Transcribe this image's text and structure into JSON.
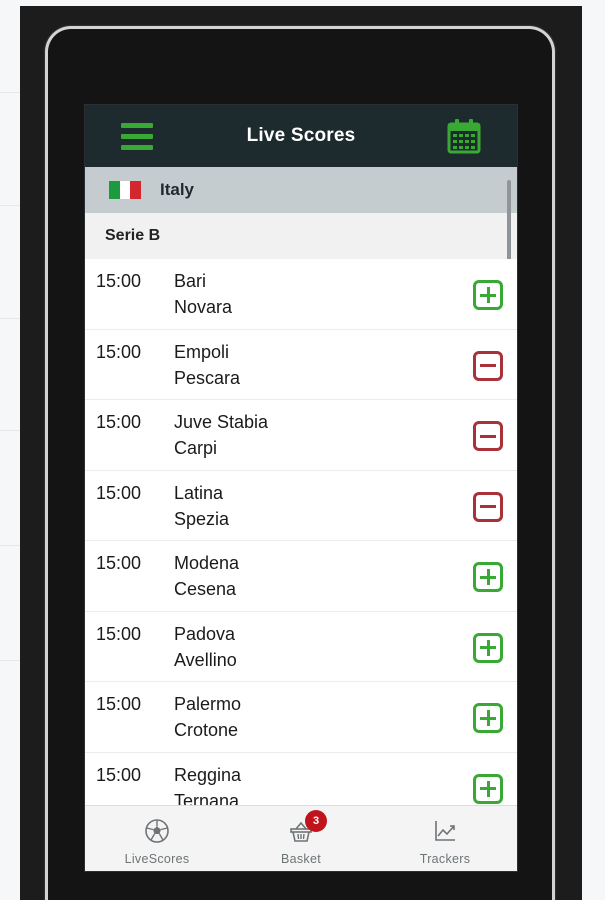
{
  "header": {
    "title": "Live Scores",
    "menu_icon": "hamburger-menu-icon",
    "calendar_icon": "calendar-icon"
  },
  "country": {
    "name": "Italy",
    "flag_colors": [
      "#1c9a3e",
      "#ffffff",
      "#d3262e"
    ]
  },
  "league": {
    "name": "Serie B"
  },
  "matches": [
    {
      "time": "15:00",
      "home": "Bari",
      "away": "Novara",
      "action": "add"
    },
    {
      "time": "15:00",
      "home": "Empoli",
      "away": "Pescara",
      "action": "remove"
    },
    {
      "time": "15:00",
      "home": "Juve Stabia",
      "away": "Carpi",
      "action": "remove"
    },
    {
      "time": "15:00",
      "home": "Latina",
      "away": "Spezia",
      "action": "remove"
    },
    {
      "time": "15:00",
      "home": "Modena",
      "away": "Cesena",
      "action": "add"
    },
    {
      "time": "15:00",
      "home": "Padova",
      "away": "Avellino",
      "action": "add"
    },
    {
      "time": "15:00",
      "home": "Palermo",
      "away": "Crotone",
      "action": "add"
    },
    {
      "time": "15:00",
      "home": "Reggina",
      "away": "Ternana",
      "action": "add"
    }
  ],
  "bottom_nav": {
    "items": [
      {
        "label": "LiveScores",
        "icon": "soccer-ball-icon"
      },
      {
        "label": "Basket",
        "icon": "basket-icon",
        "badge": "3"
      },
      {
        "label": "Trackers",
        "icon": "chart-line-icon"
      }
    ]
  },
  "colors": {
    "accent_green": "#3aa835",
    "remove_red": "#a8323a",
    "header_bg": "#1d2b2f",
    "badge_red": "#c0141c"
  }
}
